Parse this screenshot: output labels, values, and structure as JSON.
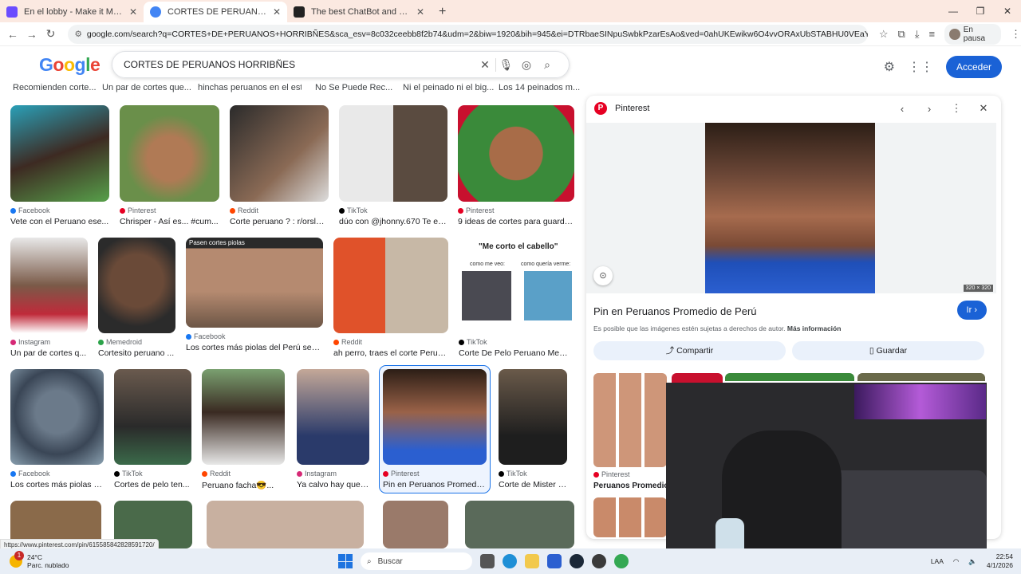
{
  "browser": {
    "tabs": [
      {
        "title": "En el lobby - Make it Meme",
        "color": "#6a4cff",
        "active": false
      },
      {
        "title": "CORTES DE PERUANOS HORRIB",
        "color": "#4285f4",
        "active": true
      },
      {
        "title": "The best ChatBot and Widgets",
        "color": "#222222",
        "active": false
      }
    ],
    "url": "google.com/search?q=CORTES+DE+PERUANOS+HORRIBÑES&sca_esv=8c032ceebb8f2b74&udm=2&biw=1920&bih=945&ei=DTRbaeSINpuSwbkPzarEsAo&ved=0ahUKEwikw6O4vvORAxUbSTABHU0VEaYQ4dUDCBI&uact=5&oq=C...",
    "profile_label": "En pausa"
  },
  "google": {
    "logo": "Google",
    "query": "CORTES DE PERUANOS HORRIBÑES",
    "sign_in": "Acceder"
  },
  "top_captions": [
    "Recomienden corte...",
    "Un par de cortes que...",
    "hinchas peruanos en el est...",
    "No Se Puede Rec...",
    "Ni el peinado ni el big...",
    "Los 14 peinados m..."
  ],
  "results": [
    {
      "src": "Facebook",
      "src_color": "#1877f2",
      "title": "Vete con el Peruano ese..."
    },
    {
      "src": "Pinterest",
      "src_color": "#e60023",
      "title": "Chrisper - Así es... #cum..."
    },
    {
      "src": "Reddit",
      "src_color": "#ff4500",
      "title": "Corte peruano ? : r/orslokx"
    },
    {
      "src": "TikTok",
      "src_color": "#000000",
      "title": "dúo con @jhonny.670 Te en..."
    },
    {
      "src": "Pinterest",
      "src_color": "#e60023",
      "title": "9 ideas de cortes para guarda..."
    },
    {
      "src": "Instagram",
      "src_color": "#d62976",
      "title": "Un par de cortes q..."
    },
    {
      "src": "Memedroid",
      "src_color": "#2ca34a",
      "title": "Cortesito peruano ..."
    },
    {
      "src": "Facebook",
      "src_color": "#1877f2",
      "title": "Los cortes más piolas del Perú segú...",
      "overlay": "Pasen cortes piolas"
    },
    {
      "src": "Reddit",
      "src_color": "#ff4500",
      "title": "ah perro, traes el corte Perua..."
    },
    {
      "src": "TikTok",
      "src_color": "#000000",
      "title": "Corte De Pelo Peruano Meme...",
      "overlay": "\"Me corto el cabello\"",
      "overlay2": "como me veo:",
      "overlay3": "como quería verme:"
    },
    {
      "src": "Facebook",
      "src_color": "#1877f2",
      "title": "Los cortes más piolas d..."
    },
    {
      "src": "TikTok",
      "src_color": "#000000",
      "title": "Cortes de pelo ten..."
    },
    {
      "src": "Reddit",
      "src_color": "#ff4500",
      "title": "Peruano facha😎..."
    },
    {
      "src": "Instagram",
      "src_color": "#d62976",
      "title": "Ya calvo hay que l..."
    },
    {
      "src": "Pinterest",
      "src_color": "#e60023",
      "title": "Pin en Peruanos Promedio..."
    },
    {
      "src": "TikTok",
      "src_color": "#000000",
      "title": "Corte de Mister Es..."
    }
  ],
  "panel": {
    "source": "Pinterest",
    "dims": "320 × 320",
    "title": "Pin en Peruanos Promedio de Perú",
    "go": "Ir",
    "note": "Es posible que las imágenes estén sujetas a derechos de autor.",
    "more": "Más información",
    "share": "Compartir",
    "save": "Guardar",
    "related_src": "Pinterest",
    "related_title": "Peruanos Promedio"
  },
  "status_url": "https://www.pinterest.com/pin/615585842828591720/",
  "taskbar": {
    "temp": "24°C",
    "weather": "Parc. nublado",
    "search": "Buscar",
    "lang": "LAA",
    "time": "22:54",
    "date": "4/1/2026",
    "badge": "1"
  }
}
